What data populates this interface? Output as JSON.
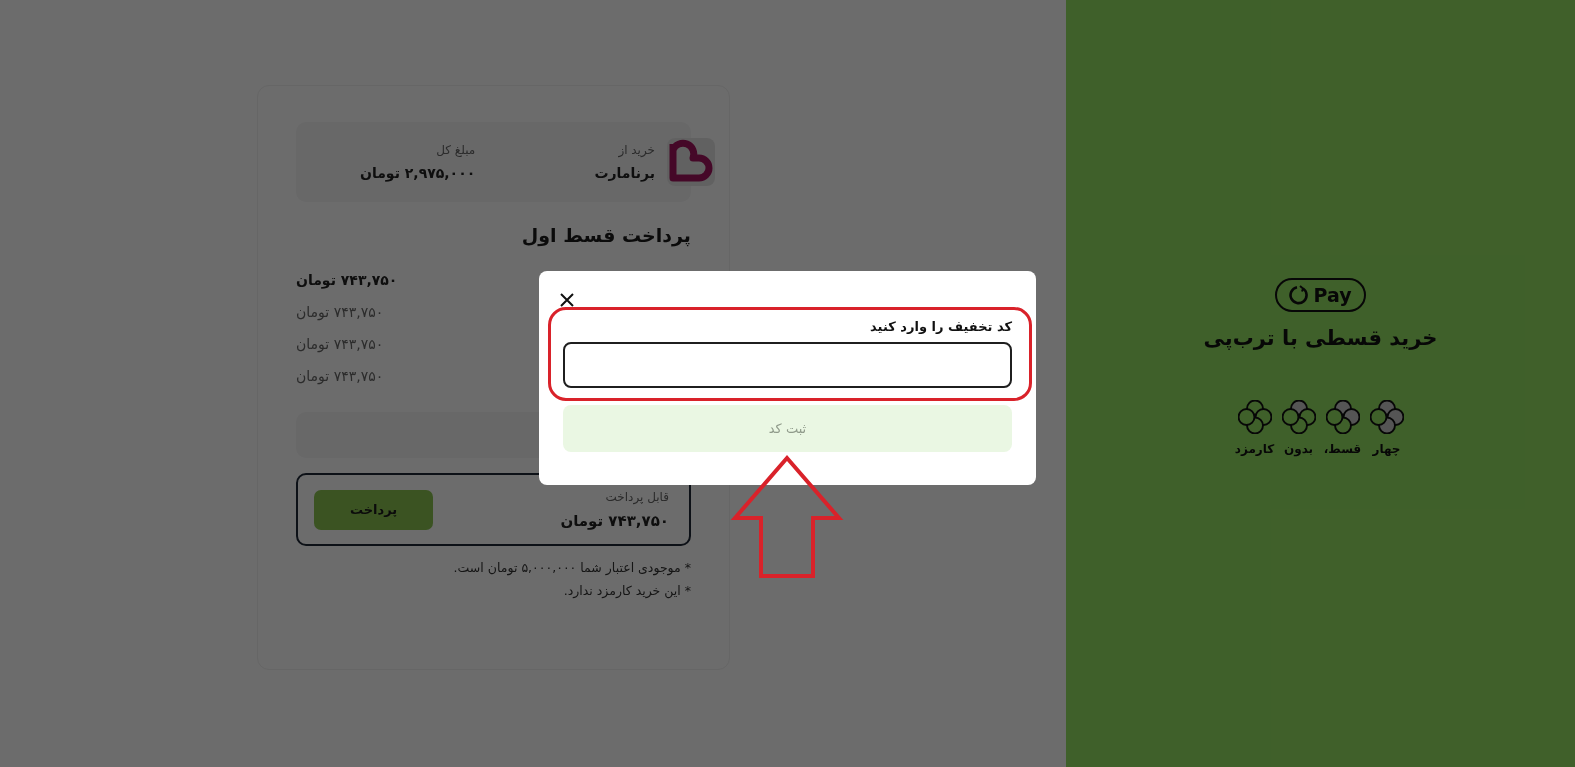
{
  "merchant": {
    "label": "خرید از",
    "name": "برنامارت",
    "total_label": "مبلغ کل",
    "total": "۲,۹۷۵,۰۰۰ تومان"
  },
  "installments": {
    "title": "پرداخت قسط اول",
    "rows": [
      {
        "amount": "۷۴۳,۷۵۰ تومان",
        "current": true
      },
      {
        "amount": "۷۴۳,۷۵۰ تومان",
        "current": false
      },
      {
        "amount": "۷۴۳,۷۵۰ تومان",
        "current": false
      },
      {
        "amount": "۷۴۳,۷۵۰ تومان",
        "current": false
      }
    ]
  },
  "payable": {
    "label": "قابل پرداخت",
    "amount": "۷۴۳,۷۵۰ تومان",
    "button": "پرداخت"
  },
  "notes": [
    "* موجودی اعتبار شما ۵,۰۰۰,۰۰۰ تومان است.",
    "* این خرید کارمزد ندارد."
  ],
  "promo": {
    "logo_text": "Pay",
    "title": "خرید قسطی با ترب‌پی",
    "steps": [
      {
        "label": "چهار",
        "kind": "three_quarters"
      },
      {
        "label": "قسط،",
        "kind": "half"
      },
      {
        "label": "بدون",
        "kind": "quarter"
      },
      {
        "label": "کارمزد",
        "kind": "empty"
      }
    ]
  },
  "dialog": {
    "label": "کد تخفیف را وارد کنید",
    "submit": "ثبت کد",
    "submit_disabled": true
  }
}
